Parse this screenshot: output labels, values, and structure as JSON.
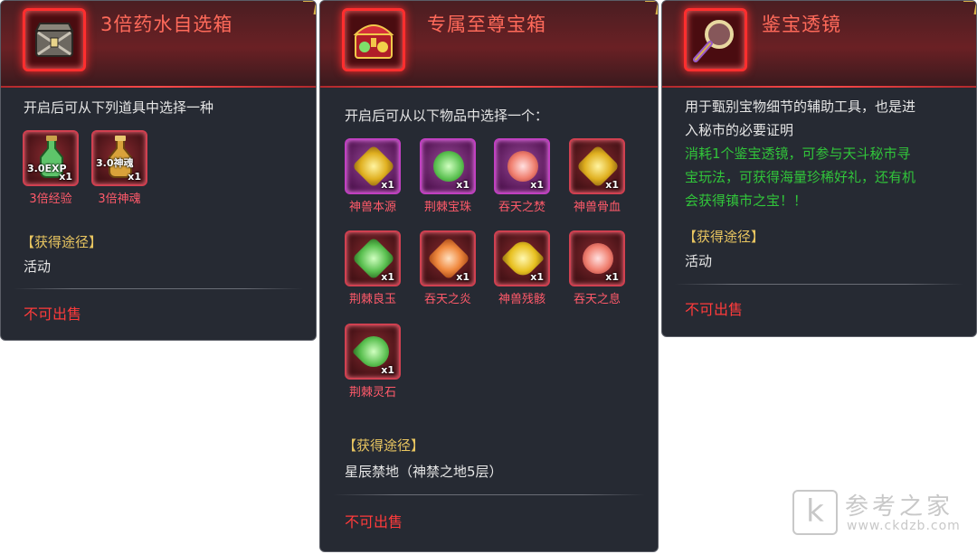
{
  "panels": [
    {
      "title": "3倍药水自选箱",
      "icon": "chest-icon",
      "description": "开启后可从下列道具中选择一种",
      "items": [
        {
          "name": "3倍经验",
          "badge": "3.0EXP",
          "qty": "x1"
        },
        {
          "name": "3倍神魂",
          "badge": "3.0神魂",
          "qty": "x1"
        }
      ],
      "source_title": "【获得途径】",
      "source_text": "活动",
      "sell_text": "不可出售"
    },
    {
      "title": "专属至尊宝箱",
      "icon": "treasure-chest-icon",
      "description": "开启后可从以下物品中选择一个：",
      "items": [
        {
          "name": "神兽本源",
          "qty": "x1"
        },
        {
          "name": "荆棘宝珠",
          "qty": "x1"
        },
        {
          "name": "吞天之焚",
          "qty": "x1"
        },
        {
          "name": "神兽骨血",
          "qty": "x1"
        },
        {
          "name": "荆棘良玉",
          "qty": "x1"
        },
        {
          "name": "吞天之炎",
          "qty": "x1"
        },
        {
          "name": "神兽残骸",
          "qty": "x1"
        },
        {
          "name": "吞天之息",
          "qty": "x1"
        },
        {
          "name": "荆棘灵石",
          "qty": "x1"
        }
      ],
      "source_title": "【获得途径】",
      "source_text": "星辰禁地（神禁之地5层）",
      "sell_text": "不可出售"
    },
    {
      "title": "鉴宝透镜",
      "icon": "magnifying-glass-icon",
      "description_lines": [
        "用于甄别宝物细节的辅助工具，也是进",
        "入秘市的必要证明"
      ],
      "highlight_lines": [
        "消耗1个鉴宝透镜，可参与天斗秘市寻",
        "宝玩法，可获得海量珍稀好礼，还有机",
        "会获得镇市之宝！！"
      ],
      "source_title": "【获得途径】",
      "source_text": "活动",
      "sell_text": "不可出售"
    }
  ],
  "watermark": {
    "logo": "k",
    "title": "参考之家",
    "url": "www.ckdzb.com"
  },
  "colors": {
    "panel_bg": "#262a33",
    "title": "#ff6a5a",
    "item_name": "#ff5a6a",
    "section_title": "#e8c560",
    "highlight": "#31c53a",
    "sell": "#ff3b3b"
  }
}
